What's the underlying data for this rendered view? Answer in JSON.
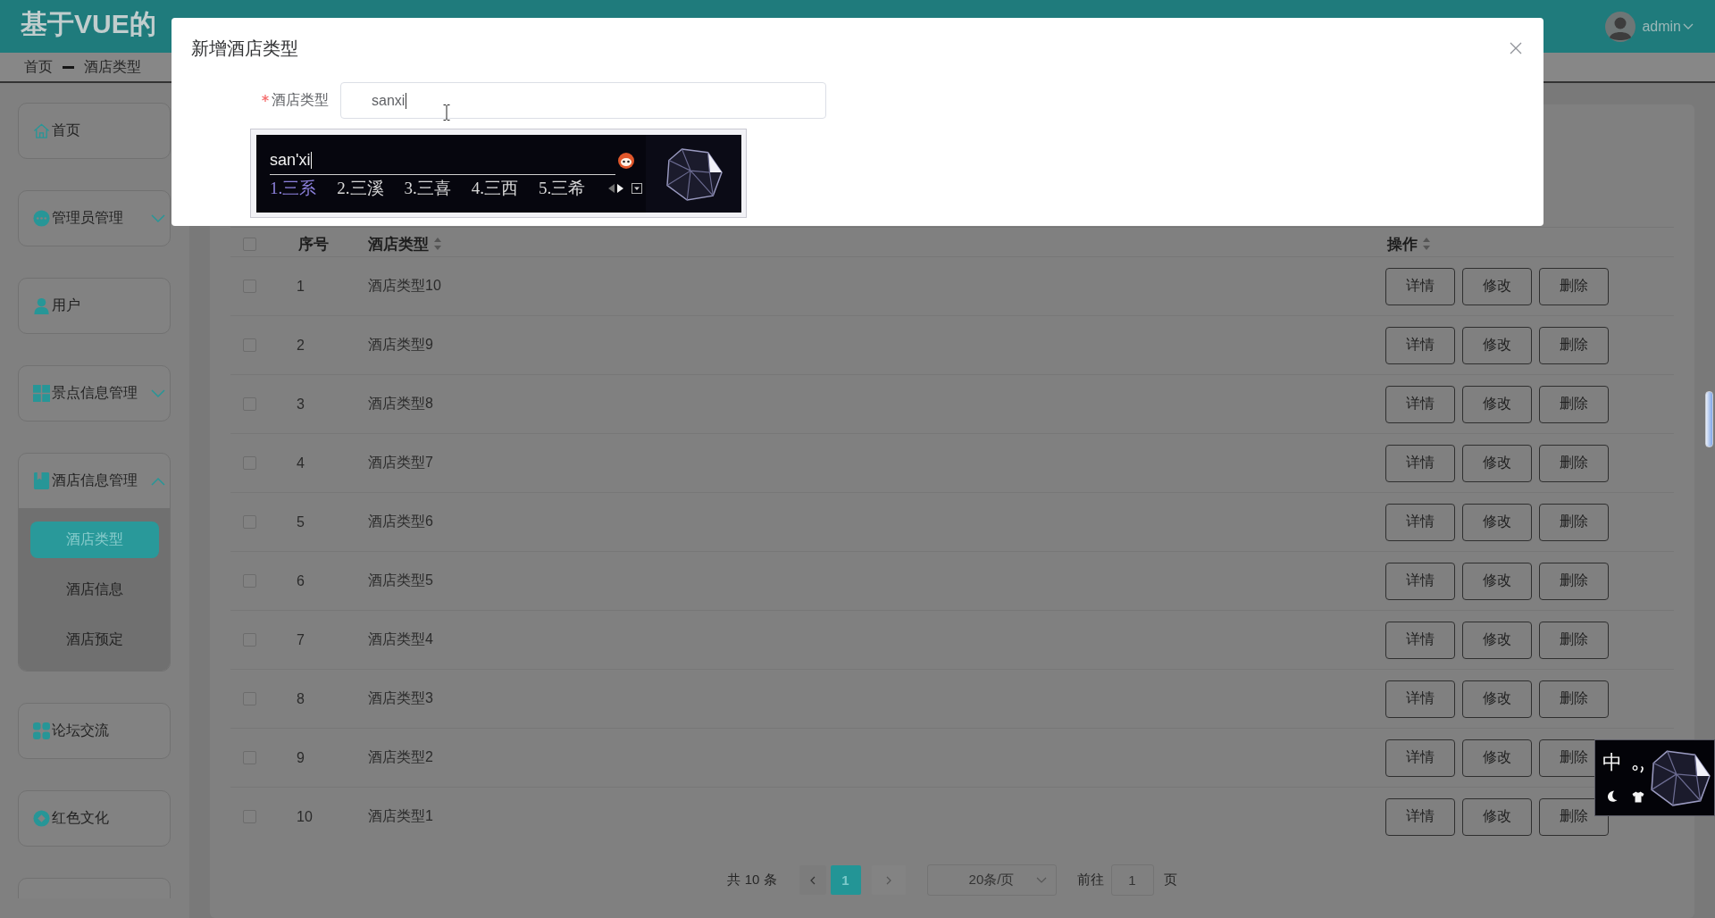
{
  "header": {
    "title": "基于VUE的",
    "user": "admin"
  },
  "breadcrumb": [
    "首页",
    "酒店类型"
  ],
  "sidebar": {
    "items": [
      {
        "kind": "link",
        "label": "首页"
      },
      {
        "kind": "group",
        "label": "管理员管理",
        "expanded": false
      },
      {
        "kind": "link",
        "label": "用户"
      },
      {
        "kind": "group",
        "label": "景点信息管理",
        "expanded": false
      },
      {
        "kind": "group",
        "label": "酒店信息管理",
        "expanded": true,
        "children": [
          {
            "label": "酒店类型",
            "selected": true
          },
          {
            "label": "酒店信息",
            "selected": false
          },
          {
            "label": "酒店预定",
            "selected": false
          }
        ]
      },
      {
        "kind": "link",
        "label": "论坛交流"
      },
      {
        "kind": "link",
        "label": "红色文化"
      },
      {
        "kind": "link"
      }
    ]
  },
  "table": {
    "select_all_checked": false,
    "columns": [
      {
        "label": "序号",
        "sortable": false
      },
      {
        "label": "酒店类型",
        "sortable": true
      },
      {
        "label": "操作",
        "sortable": true
      }
    ],
    "rows": [
      {
        "index": "1",
        "name": "酒店类型10",
        "checked": false,
        "actions": [
          "详情",
          "修改",
          "删除"
        ]
      },
      {
        "index": "2",
        "name": "酒店类型9",
        "checked": false,
        "actions": [
          "详情",
          "修改",
          "删除"
        ]
      },
      {
        "index": "3",
        "name": "酒店类型8",
        "checked": false,
        "actions": [
          "详情",
          "修改",
          "删除"
        ]
      },
      {
        "index": "4",
        "name": "酒店类型7",
        "checked": false,
        "actions": [
          "详情",
          "修改",
          "删除"
        ]
      },
      {
        "index": "5",
        "name": "酒店类型6",
        "checked": false,
        "actions": [
          "详情",
          "修改",
          "删除"
        ]
      },
      {
        "index": "6",
        "name": "酒店类型5",
        "checked": false,
        "actions": [
          "详情",
          "修改",
          "删除"
        ]
      },
      {
        "index": "7",
        "name": "酒店类型4",
        "checked": false,
        "actions": [
          "详情",
          "修改",
          "删除"
        ]
      },
      {
        "index": "8",
        "name": "酒店类型3",
        "checked": false,
        "actions": [
          "详情",
          "修改",
          "删除"
        ]
      },
      {
        "index": "9",
        "name": "酒店类型2",
        "checked": false,
        "actions": [
          "详情",
          "修改",
          "删除"
        ]
      },
      {
        "index": "10",
        "name": "酒店类型1",
        "checked": false,
        "actions": [
          "详情",
          "修改",
          "删除"
        ]
      }
    ]
  },
  "pagination": {
    "total": "共 10 条",
    "pages": [
      {
        "label": "1",
        "selected": true
      }
    ],
    "page_size": "20条/页",
    "goto_label": "前往",
    "goto_value": "1",
    "goto_suffix": "页"
  },
  "dialog": {
    "title": "新增酒店类型",
    "fields": [
      {
        "label": "酒店类型",
        "required": true,
        "value": "sanxi"
      }
    ]
  },
  "ime_popup": {
    "composition": "san'xi",
    "candidates": [
      {
        "label": "1.三系",
        "selected": true
      },
      {
        "label": "2.三溪",
        "selected": false
      },
      {
        "label": "3.三喜",
        "selected": false
      },
      {
        "label": "4.三西",
        "selected": false
      },
      {
        "label": "5.三希",
        "selected": false
      }
    ]
  },
  "ime_toolbar": {
    "mode": "中"
  }
}
